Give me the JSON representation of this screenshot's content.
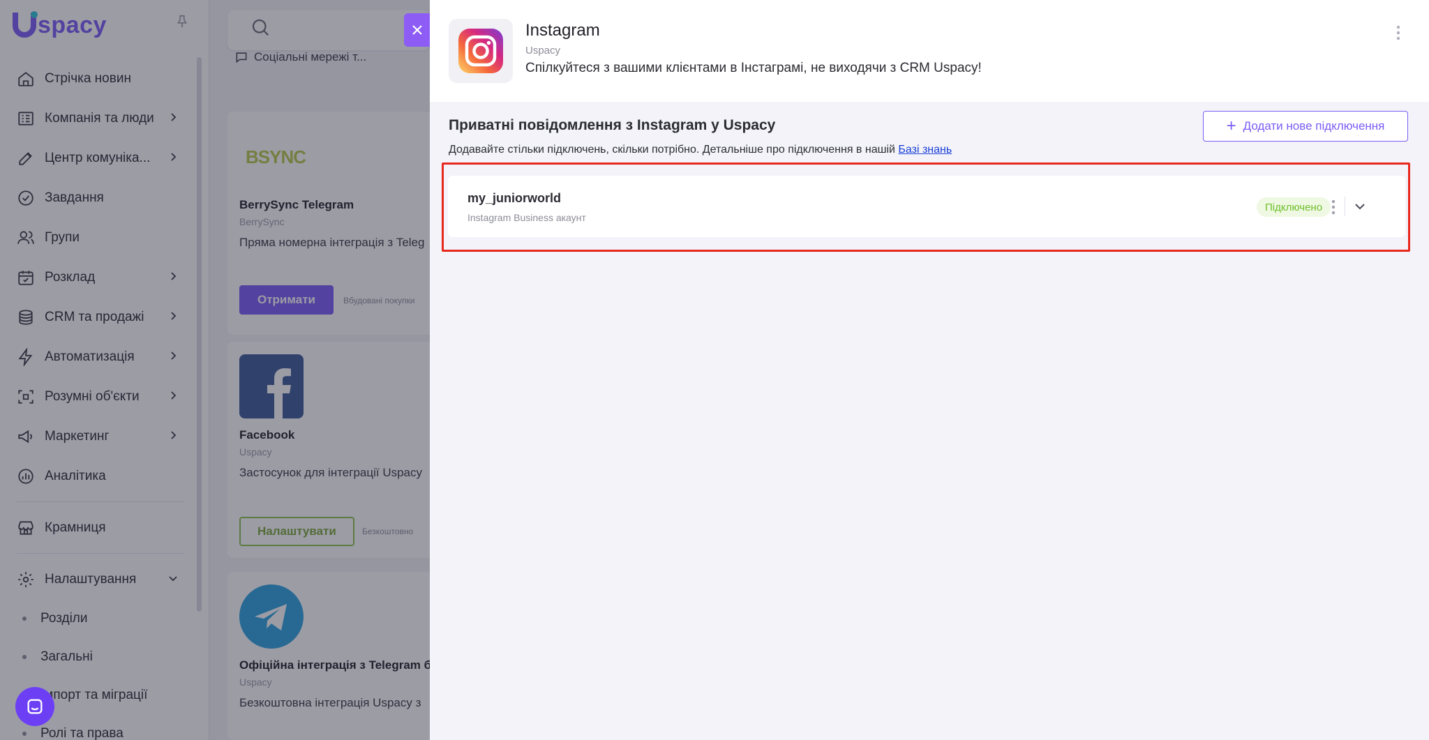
{
  "brand": {
    "logo_text": "spacy",
    "accent": "#7b5cf5"
  },
  "sidebar": {
    "items": [
      {
        "label": "Стрічка новин",
        "icon": "home-icon",
        "chevron": false
      },
      {
        "label": "Компанія та люди",
        "icon": "company-icon",
        "chevron": true
      },
      {
        "label": "Центр комуніка...",
        "icon": "edit-icon",
        "chevron": true
      },
      {
        "label": "Завдання",
        "icon": "check-circle-icon",
        "chevron": false
      },
      {
        "label": "Групи",
        "icon": "users-icon",
        "chevron": false
      },
      {
        "label": "Розклад",
        "icon": "calendar-icon",
        "chevron": true
      },
      {
        "label": "CRM та продажі",
        "icon": "coins-icon",
        "chevron": true
      },
      {
        "label": "Автоматизація",
        "icon": "lightning-icon",
        "chevron": true
      },
      {
        "label": "Розумні об'єкти",
        "icon": "smart-object-icon",
        "chevron": true
      },
      {
        "label": "Маркетинг",
        "icon": "megaphone-icon",
        "chevron": true
      },
      {
        "label": "Аналітика",
        "icon": "analytics-icon",
        "chevron": false
      },
      {
        "label": "Крамниця",
        "icon": "store-icon",
        "chevron": false
      },
      {
        "label": "Налаштування",
        "icon": "gear-icon",
        "chevron": true
      }
    ],
    "subitems": [
      "Розділи",
      "Загальні",
      "Імпорт та міграції",
      "Ролі та права"
    ]
  },
  "middle": {
    "filter_label": "Соціальні мережі т...",
    "cards": [
      {
        "logo": "BSYNC",
        "title": "BerrySync Telegram",
        "vendor": "BerrySync",
        "desc": "Пряма номерна інтеграція з Teleg",
        "action": "Отримати",
        "note": "Вбудовані покупки"
      },
      {
        "title": "Facebook",
        "vendor": "Uspacy",
        "desc": "Застосунок для інтеграції Uspacy",
        "action": "Налаштувати",
        "note": "Безкоштовно"
      },
      {
        "title": "Офіційна інтеграція з Telegram бо",
        "vendor": "Uspacy",
        "desc": "Безкоштовна інтеграція Uspacy з"
      }
    ]
  },
  "drawer": {
    "app_title": "Instagram",
    "app_vendor": "Uspacy",
    "app_desc": "Спілкуйтеся з вашими клієнтами в Інстаграмі, не виходячи з CRM Uspacy!",
    "section_title": "Приватні повідомлення з Instagram у Uspacy",
    "section_desc": "Додавайте стільки підключень, скільки потрібно. Детальніше про підключення в нашій",
    "section_link": "Базі знань",
    "add_button": "Додати нове підключення",
    "connection": {
      "name": "my_juniorworld",
      "type": "Instagram Business акаунт",
      "status": "Підключено",
      "status_color": "#6fbf2b"
    }
  }
}
